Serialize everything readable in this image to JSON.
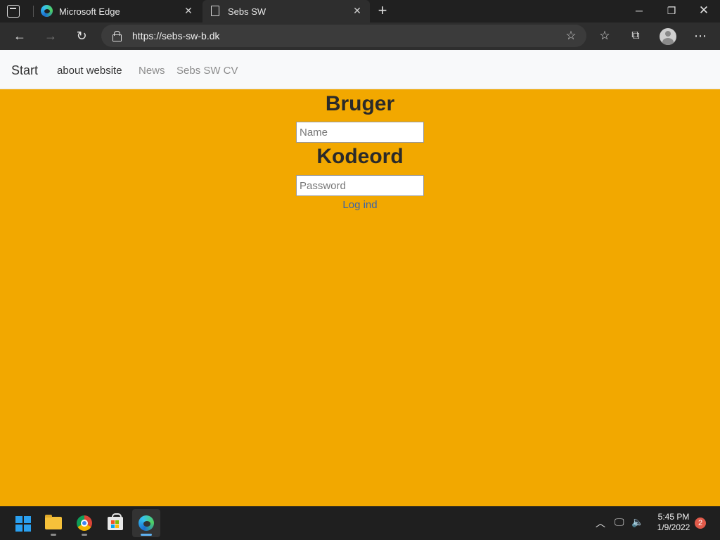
{
  "browser": {
    "tabs": [
      {
        "title": "Microsoft Edge",
        "icon": "edge-icon",
        "active": false
      },
      {
        "title": "Sebs SW",
        "icon": "page-icon",
        "active": true
      }
    ],
    "url": "https://sebs-sw-b.dk"
  },
  "site": {
    "nav": {
      "brand": "Start",
      "links": [
        "about website",
        "News",
        "Sebs SW CV"
      ]
    },
    "login": {
      "user_heading": "Bruger",
      "name_placeholder": "Name",
      "password_heading": "Kodeord",
      "password_placeholder": "Password",
      "submit_label": "Log ind"
    },
    "background_color": "#f2a800"
  },
  "taskbar": {
    "apps": [
      "start-icon",
      "file-explorer-icon",
      "chrome-icon",
      "store-icon",
      "edge-icon"
    ],
    "time": "5:45 PM",
    "date": "1/9/2022",
    "notification_count": "2"
  }
}
